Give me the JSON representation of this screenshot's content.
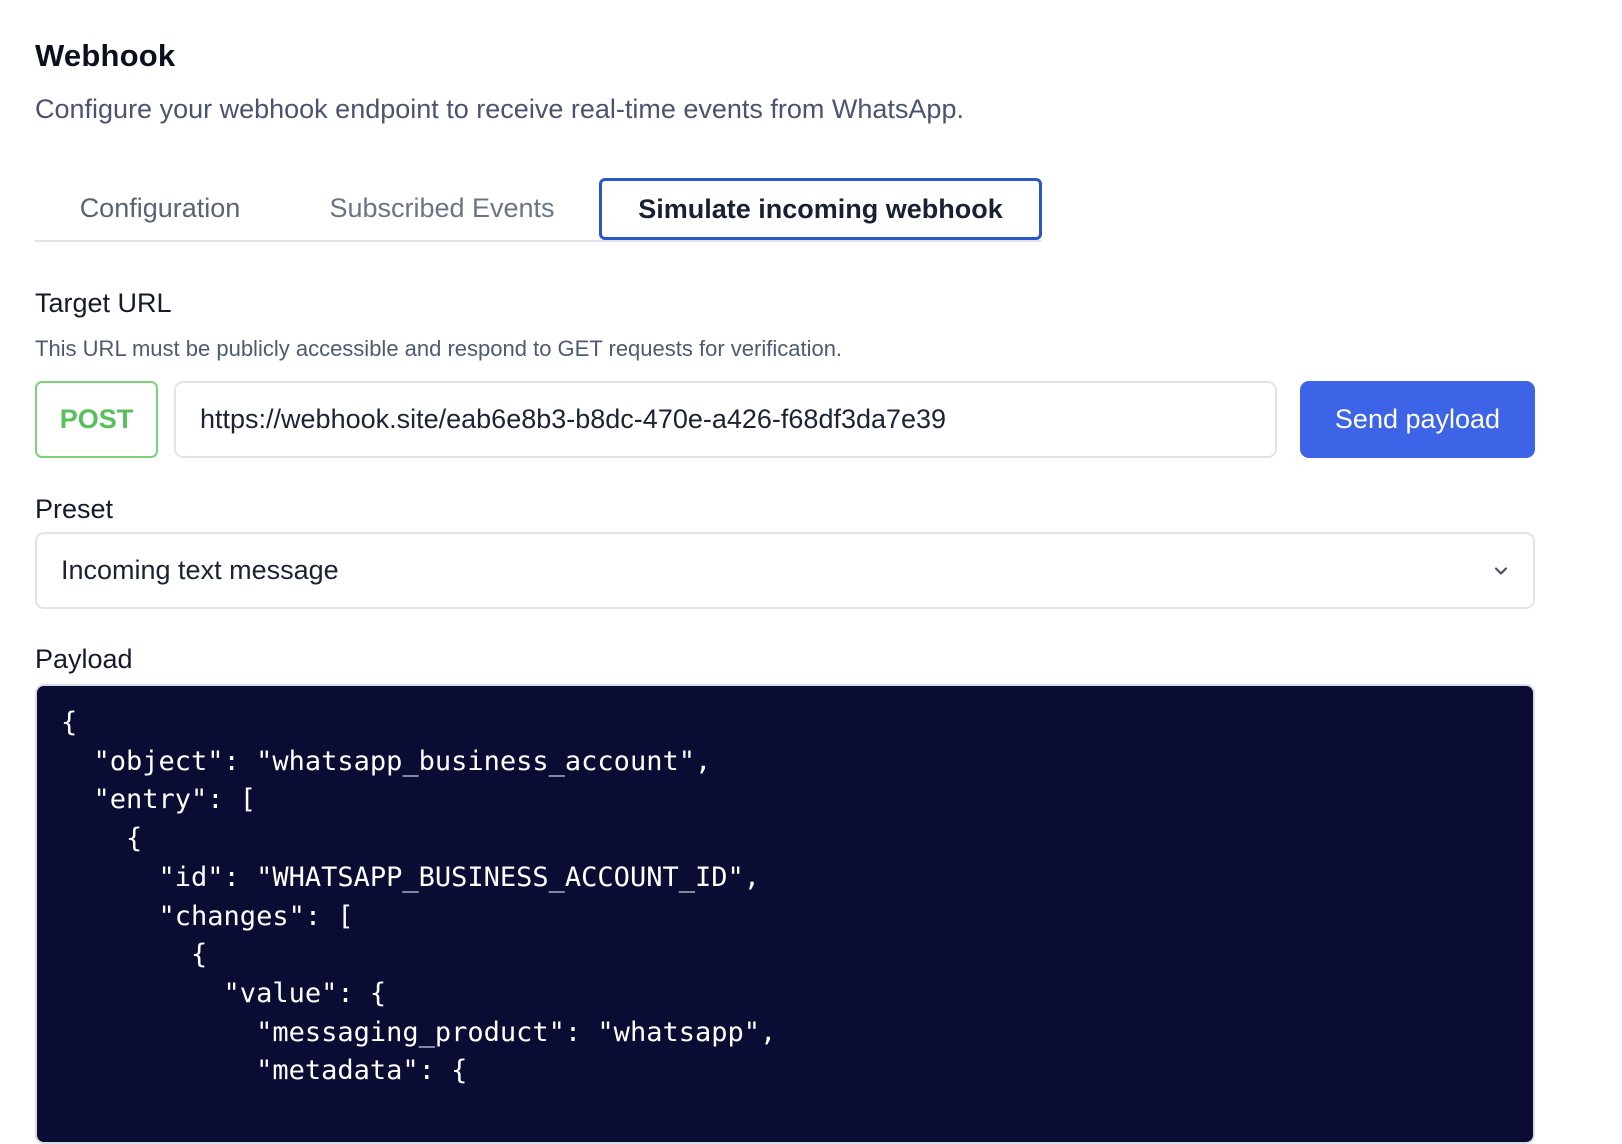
{
  "header": {
    "title": "Webhook",
    "subtitle": "Configure your webhook endpoint to receive real-time events from WhatsApp."
  },
  "tabs": [
    {
      "label": "Configuration",
      "active": false
    },
    {
      "label": "Subscribed Events",
      "active": false
    },
    {
      "label": "Simulate incoming webhook",
      "active": true
    }
  ],
  "target_url": {
    "label": "Target URL",
    "helper": "This URL must be publicly accessible and respond to GET requests for verification.",
    "method": "POST",
    "value": "https://webhook.site/eab6e8b3-b8dc-470e-a426-f68df3da7e39"
  },
  "send_button": {
    "label": "Send payload"
  },
  "preset": {
    "label": "Preset",
    "selected": "Incoming text message",
    "icon": "chevron-down-icon"
  },
  "payload": {
    "label": "Payload",
    "code": "{\n  \"object\": \"whatsapp_business_account\",\n  \"entry\": [\n    {\n      \"id\": \"WHATSAPP_BUSINESS_ACCOUNT_ID\",\n      \"changes\": [\n        {\n          \"value\": {\n            \"messaging_product\": \"whatsapp\",\n            \"metadata\": {"
  },
  "colors": {
    "primary": "#3d64e6",
    "active_tab_border": "#2858c8",
    "method_green": "#58c05a",
    "code_background": "#0b0c33"
  }
}
